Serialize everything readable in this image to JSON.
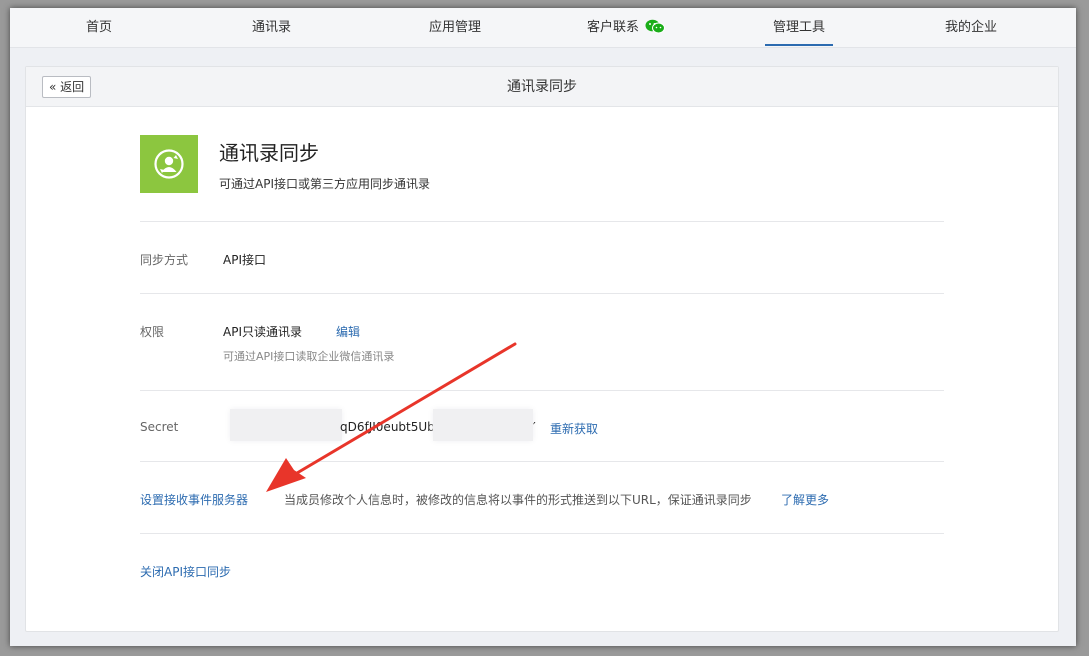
{
  "nav": {
    "items": [
      {
        "label": "首页"
      },
      {
        "label": "通讯录"
      },
      {
        "label": "应用管理"
      },
      {
        "label": "客户联系"
      },
      {
        "label": "管理工具"
      },
      {
        "label": "我的企业"
      }
    ],
    "active_index": 4
  },
  "header": {
    "back_label": "« 返回",
    "title": "通讯录同步"
  },
  "app": {
    "name": "通讯录同步",
    "description": "可通过API接口或第三方应用同步通讯录"
  },
  "sync_mode": {
    "label": "同步方式",
    "value": "API接口"
  },
  "permission": {
    "label": "权限",
    "value": "API只读通讯录",
    "edit_label": "编辑",
    "sub": "可通过API接口读取企业微信通讯录"
  },
  "secret": {
    "label": "Secret",
    "visible_fragment": "qD6fJI0eubt5Ubl",
    "trailing_char": "′",
    "refresh_label": "重新获取"
  },
  "event_server": {
    "link_label": "设置接收事件服务器",
    "description": "当成员修改个人信息时，被修改的信息将以事件的形式推送到以下URL，保证通讯录同步",
    "learn_more_label": "了解更多"
  },
  "close_sync": {
    "link_label": "关闭API接口同步"
  },
  "colors": {
    "accent": "#2c6bb0",
    "logo_green": "#8cc63f",
    "arrow_red": "#e8352a"
  }
}
